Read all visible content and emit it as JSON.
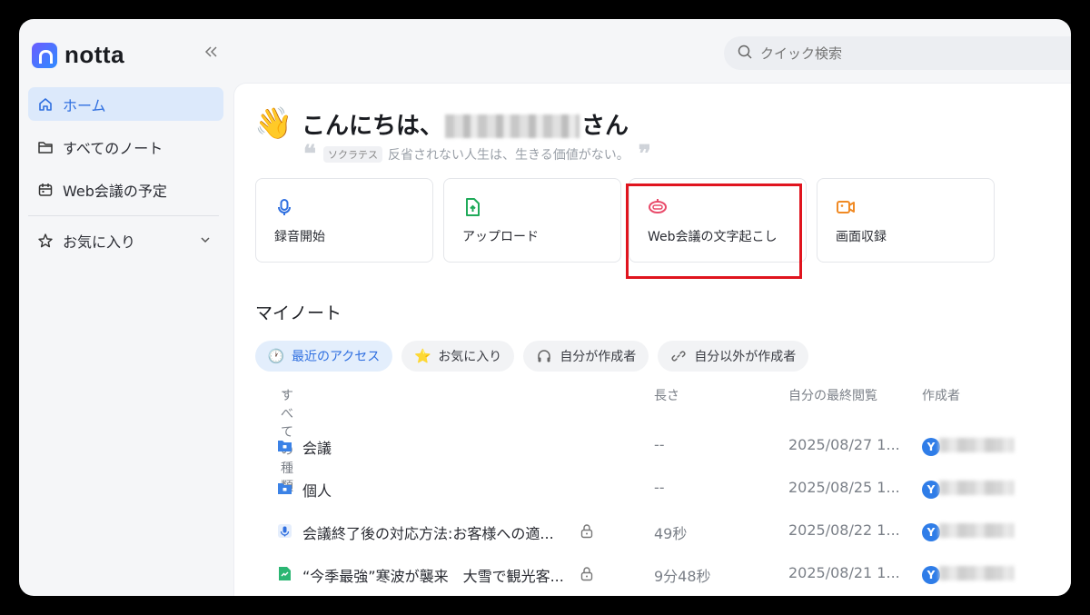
{
  "app": {
    "logo_text": "notta"
  },
  "search": {
    "placeholder": "クイック検索"
  },
  "sidebar": {
    "items": [
      {
        "label": "ホーム",
        "icon": "home-icon"
      },
      {
        "label": "すべてのノート",
        "icon": "folder-icon"
      },
      {
        "label": "Web会議の予定",
        "icon": "calendar-icon"
      },
      {
        "label": "お気に入り",
        "icon": "star-icon"
      }
    ]
  },
  "greeting": {
    "prefix": "こんにちは、",
    "suffix": "さん",
    "quote_author": "ソクラテス",
    "quote_text": "反省されない人生は、生きる価値がない。"
  },
  "actions": [
    {
      "label": "録音開始",
      "icon": "microphone-icon",
      "color": "#2f6fe0"
    },
    {
      "label": "アップロード",
      "icon": "upload-icon",
      "color": "#1faa59"
    },
    {
      "label": "Web会議の文字起こし",
      "icon": "meeting-bot-icon",
      "color": "#e94a6a"
    },
    {
      "label": "画面収録",
      "icon": "video-camera-icon",
      "color": "#f08a24"
    }
  ],
  "notes_section": {
    "title": "マイノート",
    "filters": [
      {
        "label": "最近のアクセス",
        "icon": "clock-icon"
      },
      {
        "label": "お気に入り",
        "icon": "star-icon"
      },
      {
        "label": "自分が作成者",
        "icon": "headphones-icon"
      },
      {
        "label": "自分以外が作成者",
        "icon": "link-icon"
      }
    ],
    "columns": {
      "type": "すべての種類",
      "length": "長さ",
      "last_viewed": "自分の最終閲覧",
      "creator": "作成者"
    },
    "rows": [
      {
        "name": "会議",
        "type": "folder",
        "length": "--",
        "date": "2025/08/27 1...",
        "avatar": "Y",
        "locked": false
      },
      {
        "name": "個人",
        "type": "folder",
        "length": "--",
        "date": "2025/08/25 1...",
        "avatar": "Y",
        "locked": false
      },
      {
        "name": "会議終了後の対応方法:お客様への適...",
        "type": "audio",
        "length": "49秒",
        "date": "2025/08/22 1...",
        "avatar": "Y",
        "locked": true
      },
      {
        "name": "“今季最強”寒波が襲来　大雪で観光客...",
        "type": "document",
        "length": "9分48秒",
        "date": "2025/08/21 1...",
        "avatar": "Y",
        "locked": true
      }
    ]
  }
}
